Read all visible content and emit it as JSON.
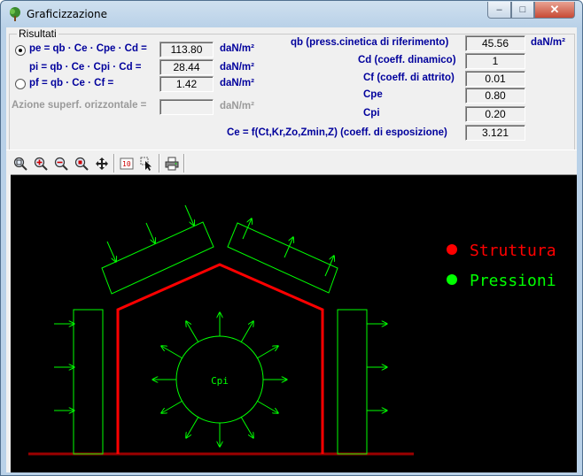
{
  "window": {
    "title": "Graficizzazione",
    "minimize": "–",
    "maximize": "□",
    "close": "✕",
    "icon": "tree-icon"
  },
  "results": {
    "group_title": "Risultati",
    "pe_formula": "pe = qb · Ce · Cpe · Cd =",
    "pe_value": "113.80",
    "pi_formula": "pi = qb · Ce · Cpi · Cd =",
    "pi_value": "28.44",
    "pf_formula": "pf = qb · Ce · Cf      =",
    "pf_value": "1.42",
    "azione_label": "Azione superf. orizzontale  =",
    "azione_value": "",
    "unit": "daN/m²"
  },
  "params": {
    "qb_label": "qb (press.cinetica di riferimento)",
    "qb_value": "45.56",
    "qb_unit": "daN/m²",
    "cd_label": "Cd (coeff. dinamico)",
    "cd_value": "1",
    "cf_label": "Cf (coeff. di attrito)",
    "cf_value": "0.01",
    "cpe_label": "Cpe",
    "cpe_value": "0.80",
    "cpi_label": "Cpi",
    "cpi_value": "0.20",
    "ce_label": "Ce = f(Ct,Kr,Zo,Zmin,Z)  (coeff. di esposizione)",
    "ce_value": "3.121"
  },
  "toolbar": {
    "buttons": [
      "zoom-fit-icon",
      "zoom-in-icon",
      "zoom-out-icon",
      "zoom-window-icon",
      "pan-icon",
      "text-icon",
      "select-pointer-icon",
      "print-icon"
    ]
  },
  "drawing": {
    "cpi_label": "Cpi",
    "legend": [
      {
        "label": "Struttura",
        "color": "#ff0000"
      },
      {
        "label": "Pressioni",
        "color": "#00ff00"
      }
    ],
    "colors": {
      "structure": "#ff0000",
      "pressure": "#00ff00",
      "ground": "#9c0000",
      "background": "#000000"
    }
  }
}
